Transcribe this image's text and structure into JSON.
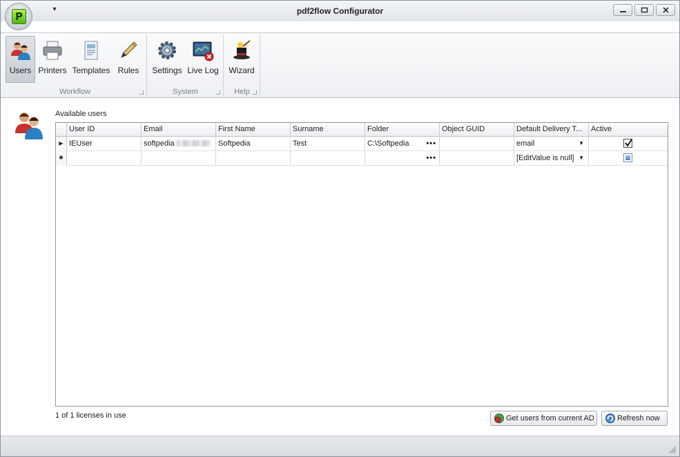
{
  "window": {
    "title": "pdf2flow Configurator",
    "app_logo_letter": "P"
  },
  "ribbon": {
    "groups": [
      {
        "caption": "Workflow"
      },
      {
        "caption": "System"
      },
      {
        "caption": "Help"
      }
    ],
    "buttons": {
      "users": "Users",
      "printers": "Printers",
      "templates": "Templates",
      "rules": "Rules",
      "settings": "Settings",
      "live_log": "Live Log",
      "wizard": "Wizard"
    },
    "active_button": "users"
  },
  "main": {
    "section_label": "Available users",
    "columns": [
      "User ID",
      "Email",
      "First Name",
      "Surname",
      "Folder",
      "Object GUID",
      "Default Delivery T...",
      "Active"
    ],
    "rows": [
      {
        "user_id": "IEUser",
        "email": "softpedia",
        "first_name": "Softpedia",
        "surname": "Test",
        "folder": "C:\\Softpedia",
        "object_guid": "",
        "default_delivery": "email",
        "active": true
      }
    ],
    "new_row": {
      "default_delivery": "[EditValue is null]"
    },
    "licenses_text": "1 of 1 licenses in use",
    "buttons": {
      "get_users_ad": "Get users from current AD",
      "refresh_now": "Refresh now"
    }
  },
  "colors": {
    "accent": "#4f7fb8",
    "logo_green": "#54b51a"
  },
  "icons": {
    "users": "users-icon",
    "printers": "printer-icon",
    "templates": "template-icon",
    "rules": "pen-icon",
    "settings": "gear-icon",
    "live_log": "monitor-icon",
    "wizard": "magic-hat-icon"
  }
}
